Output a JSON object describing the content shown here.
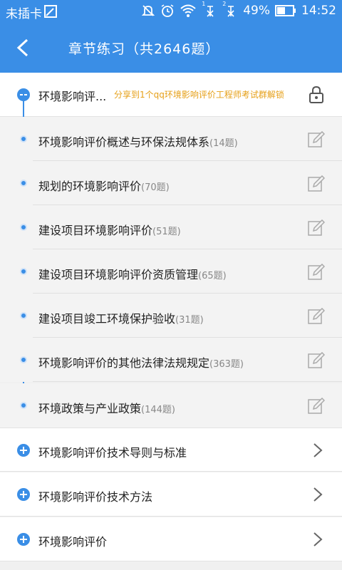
{
  "status": {
    "carrier": "未插卡",
    "sim1_label": "1",
    "sim2_label": "2",
    "battery": "49%",
    "time": "14:52"
  },
  "header": {
    "title": "章节练习（共2646题）"
  },
  "expanded": {
    "label": "环境影响评...",
    "share": "分享到1个qq环境影响评价工程师考试群解锁"
  },
  "sub_items": [
    {
      "name": "环境影响评价概述与环保法规体系",
      "count": "(14题)"
    },
    {
      "name": "规划的环境影响评价",
      "count": "(70题)"
    },
    {
      "name": "建设项目环境影响评价",
      "count": "(51题)"
    },
    {
      "name": "建设项目环境影响评价资质管理",
      "count": "(65题)"
    },
    {
      "name": "建设项目竣工环境保护验收",
      "count": "(31题)"
    },
    {
      "name": "环境影响评价的其他法律法规规定",
      "count": "(363题)"
    },
    {
      "name": "环境政策与产业政策",
      "count": "(144题)"
    }
  ],
  "collapsed": [
    {
      "label": "环境影响评价技术导则与标准"
    },
    {
      "label": "环境影响评价技术方法"
    },
    {
      "label": "环境影响评价"
    }
  ]
}
